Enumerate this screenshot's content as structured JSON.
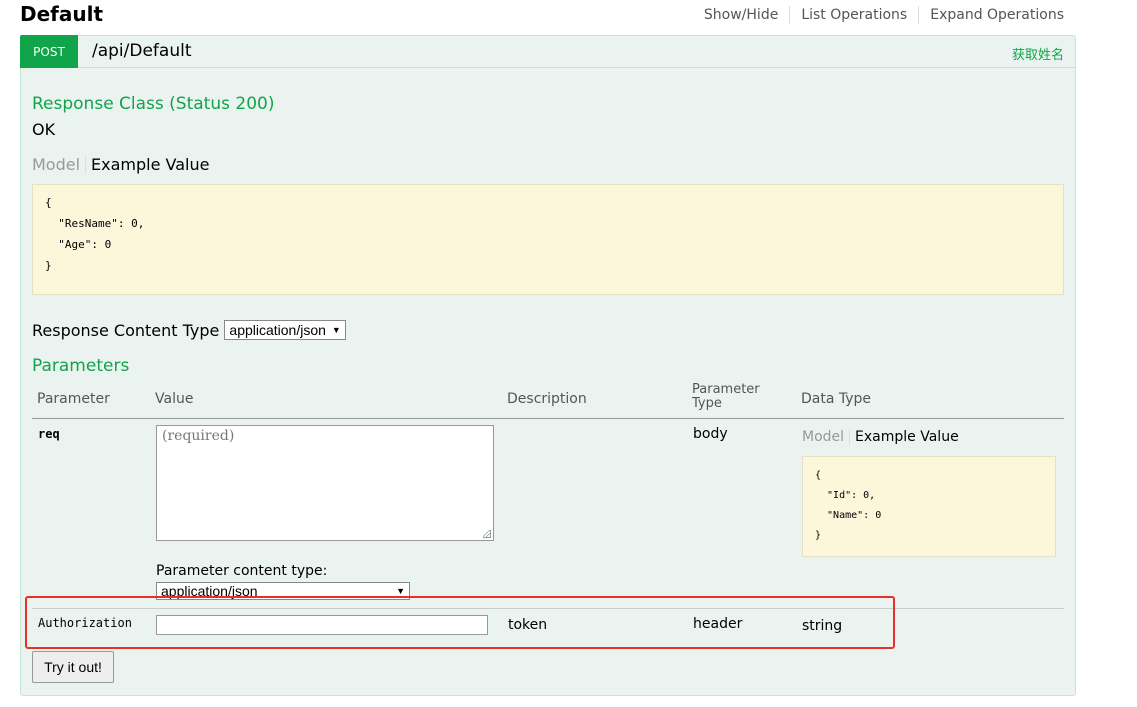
{
  "heading": "Default",
  "nav": {
    "show_hide": "Show/Hide",
    "list_operations": "List Operations",
    "expand_operations": "Expand Operations"
  },
  "operation": {
    "verb": "POST",
    "path": "/api/Default",
    "summary": "获取姓名",
    "colors": {
      "verb_bg": "#10a54a",
      "panel_bg": "#ebf3f0",
      "accent": "#10a54a"
    }
  },
  "response": {
    "class_title": "Response Class (Status 200)",
    "status_text": "OK",
    "model_tab": "Model",
    "example_tab": "Example Value",
    "example_lines": [
      "{",
      "  \"ResName\": 0,",
      "  \"Age\": 0",
      "}"
    ]
  },
  "response_content_type": {
    "label": "Response Content Type",
    "selected": "application/json"
  },
  "parameters": {
    "title": "Parameters",
    "headers": {
      "parameter": "Parameter",
      "value": "Value",
      "description": "Description",
      "param_type_1": "Parameter",
      "param_type_2": "Type",
      "data_type": "Data Type"
    },
    "req": {
      "name": "req",
      "placeholder": "(required)",
      "param_type": "body",
      "model_tab": "Model",
      "example_tab": "Example Value",
      "example_lines": [
        "{",
        "  \"Id\": 0,",
        "  \"Name\": 0",
        "}"
      ],
      "content_type_label": "Parameter content type:",
      "content_type_selected": "application/json"
    },
    "authorization": {
      "name": "Authorization",
      "value": "",
      "description": "token",
      "param_type": "header",
      "data_type": "string"
    }
  },
  "try_button": "Try it out!",
  "highlight_color": "#e8302a"
}
